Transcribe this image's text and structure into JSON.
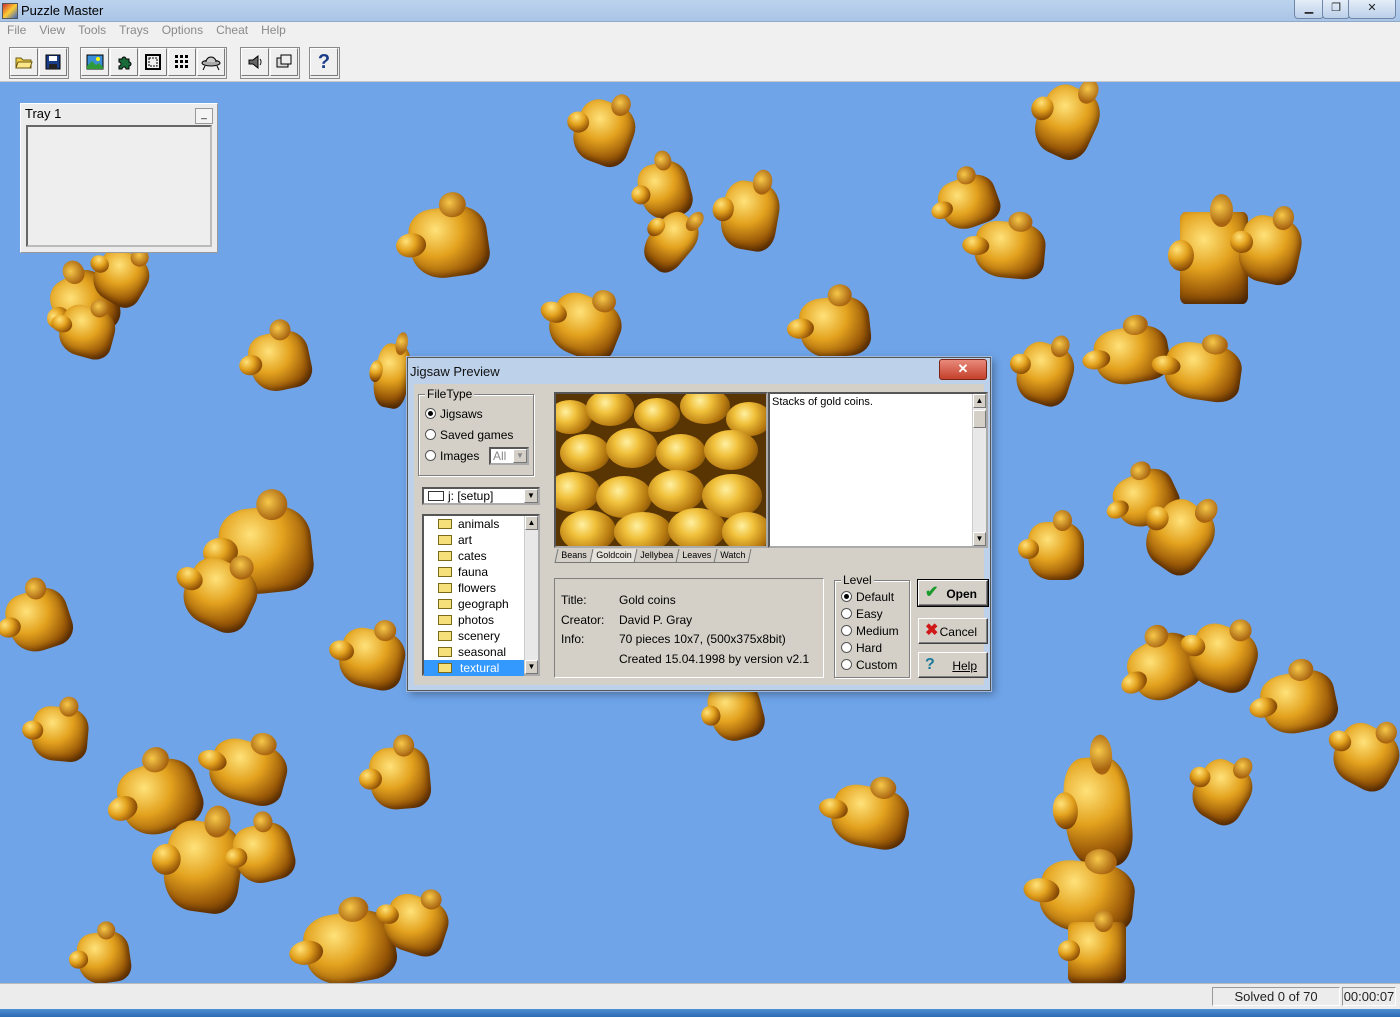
{
  "window": {
    "title": "Puzzle Master",
    "min_glyph": "▁",
    "max_glyph": "❐",
    "close_glyph": "✕"
  },
  "menu": [
    "File",
    "View",
    "Tools",
    "Trays",
    "Options",
    "Cheat",
    "Help"
  ],
  "toolbar": {
    "help_glyph": "?",
    "icons": [
      "open-folder-icon",
      "save-disk-icon",
      "picture-icon",
      "puzzle-piece-icon",
      "border-frame-icon",
      "grid-icon",
      "flying-saucer-icon",
      "speaker-icon",
      "tray-icon",
      "help-icon"
    ]
  },
  "tray": {
    "title": "Tray 1",
    "min_glyph": "_"
  },
  "dialog": {
    "title": "Jigsaw Preview",
    "close_glyph": "✕",
    "filetype": {
      "legend": "FileType",
      "options": [
        {
          "label": "Jigsaws",
          "selected": true
        },
        {
          "label": "Saved games",
          "selected": false
        },
        {
          "label": "Images",
          "selected": false
        }
      ],
      "images_filter": "All"
    },
    "drive": "j: [setup]",
    "folders": [
      {
        "label": "animals",
        "selected": false
      },
      {
        "label": "art",
        "selected": false
      },
      {
        "label": "cates",
        "selected": false
      },
      {
        "label": "fauna",
        "selected": false
      },
      {
        "label": "flowers",
        "selected": false
      },
      {
        "label": "geograph",
        "selected": false
      },
      {
        "label": "photos",
        "selected": false
      },
      {
        "label": "scenery",
        "selected": false
      },
      {
        "label": "seasonal",
        "selected": false
      },
      {
        "label": "textural",
        "selected": true
      }
    ],
    "description": "Stacks of gold coins.",
    "tabs": [
      "Beans",
      "Goldcoin",
      "Jellybea",
      "Leaves",
      "Watch"
    ],
    "info": {
      "title_label": "Title:",
      "title": "Gold coins",
      "creator_label": "Creator:",
      "creator": "David P. Gray",
      "info_label": "Info:",
      "info1": "70 pieces 10x7, (500x375x8bit)",
      "info2": "Created 15.04.1998 by version v2.1"
    },
    "level": {
      "legend": "Level",
      "options": [
        {
          "label": "Default",
          "selected": true
        },
        {
          "label": "Easy",
          "selected": false
        },
        {
          "label": "Medium",
          "selected": false
        },
        {
          "label": "Hard",
          "selected": false
        },
        {
          "label": "Custom",
          "selected": false
        }
      ]
    },
    "buttons": {
      "open": "Open",
      "open_glyph": "✔",
      "cancel": "Cancel",
      "cancel_glyph": "✖",
      "help": "Help",
      "help_glyph": "?"
    },
    "scroll_up_glyph": "▲",
    "scroll_down_glyph": "▼",
    "dropdown_glyph": "▼"
  },
  "status": {
    "solved": "Solved 0 of 70",
    "timer": "00:00:07"
  },
  "colors": {
    "desktop": "#6fa4e8",
    "piece_gold": "#e3a21e",
    "dialog_face": "#d4d0c8"
  }
}
